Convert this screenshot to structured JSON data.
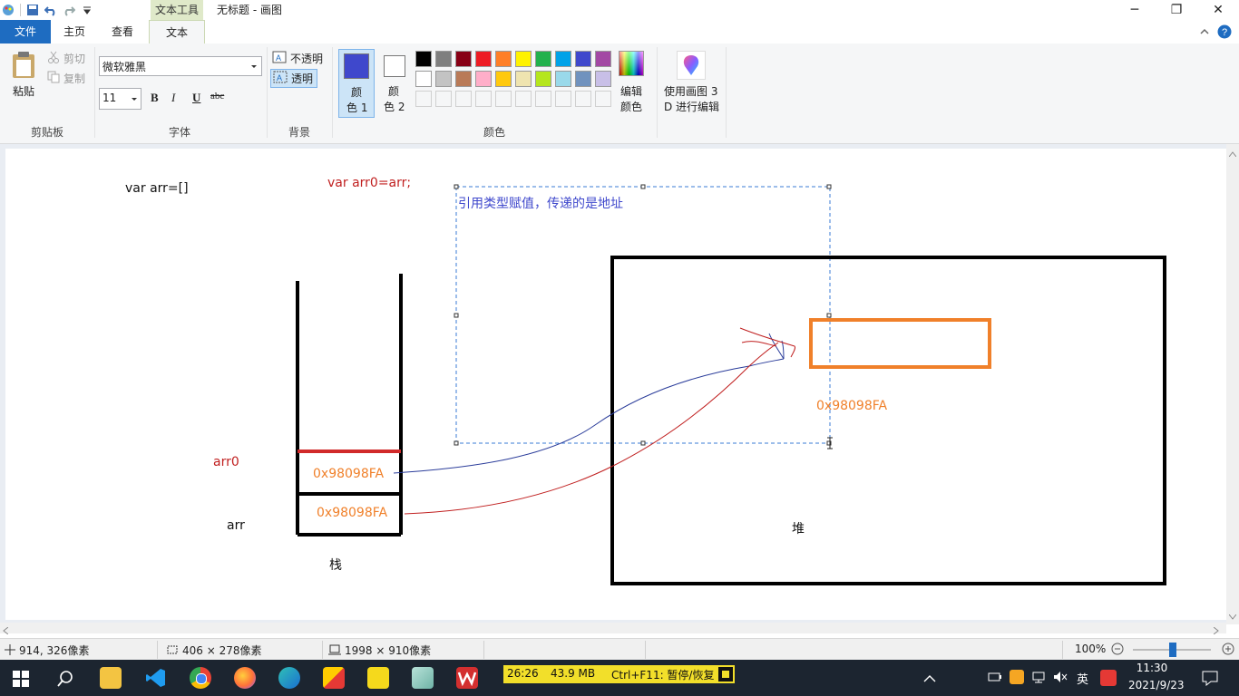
{
  "titlebar": {
    "context_tab": "文本工具",
    "title": "无标题 - 画图",
    "minimize": "─",
    "restore": "❐",
    "close": "✕"
  },
  "tabs": {
    "file": "文件",
    "home": "主页",
    "view": "查看",
    "text": "文本"
  },
  "ribbon": {
    "clipboard": {
      "paste": "粘贴",
      "cut": "剪切",
      "copy": "复制",
      "label": "剪贴板"
    },
    "font": {
      "family": "微软雅黑",
      "size": "11",
      "bold": "B",
      "italic": "I",
      "underline": "U",
      "strike": "abc",
      "label": "字体"
    },
    "background": {
      "opaque": "不透明",
      "transparent": "透明",
      "label": "背景"
    },
    "colors": {
      "color1_line1": "颜",
      "color1_line2": "色 1",
      "color2_line1": "颜",
      "color2_line2": "色 2",
      "edit_line1": "编辑",
      "edit_line2": "颜色",
      "label": "颜色",
      "color1_value": "#3f48cc",
      "color2_value": "#ffffff",
      "palette_row1": [
        "#000000",
        "#7f7f7f",
        "#880015",
        "#ed1c24",
        "#ff7f27",
        "#fff200",
        "#22b14c",
        "#00a2e8",
        "#3f48cc",
        "#a349a4"
      ],
      "palette_row2": [
        "#ffffff",
        "#c3c3c3",
        "#b97a57",
        "#ffaec9",
        "#ffc90e",
        "#efe4b0",
        "#b5e61d",
        "#99d9ea",
        "#7092be",
        "#c8bfe7"
      ]
    },
    "paint3d": {
      "line1": "使用画图 3",
      "line2": "D 进行编辑"
    }
  },
  "canvas": {
    "code_arr": "var arr=[]",
    "code_arr0": "var arr0=arr;",
    "textbox": "引用类型赋值，传递的是地址",
    "label_arr0": "arr0",
    "label_arr": "arr",
    "addr_stack_top": "0x98098FA",
    "addr_stack_bottom": "0x98098FA",
    "addr_heap": "0x98098FA",
    "label_stack": "栈",
    "label_heap": "堆"
  },
  "status": {
    "cursor_pos": "914, 326像素",
    "selection_size": "406 × 278像素",
    "image_size": "1998 × 910像素",
    "zoom": "100%"
  },
  "taskbar": {
    "recorder": {
      "time": "26:26",
      "size": "43.9 MB",
      "hint": "Ctrl+F11: 暂停/恢复"
    },
    "ime": "英",
    "clock_time": "11:30",
    "clock_date": "2021/9/23"
  }
}
